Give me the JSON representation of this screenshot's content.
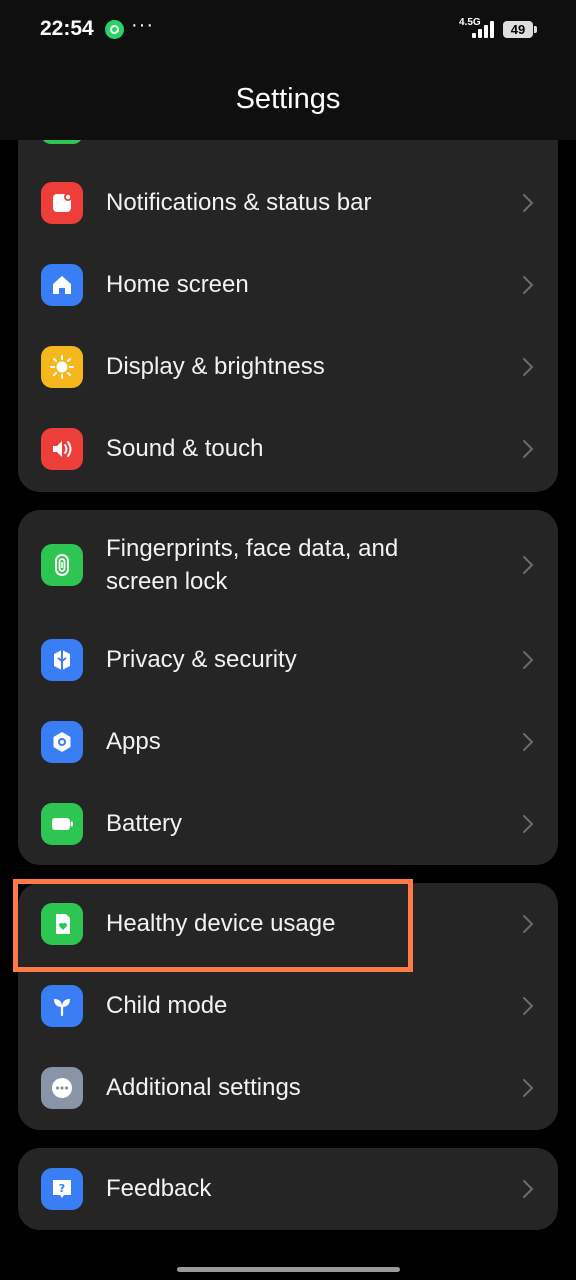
{
  "status_bar": {
    "time": "22:54",
    "network": "4.5G",
    "battery": "49",
    "overflow": "···"
  },
  "header": {
    "title": "Settings"
  },
  "groups": [
    {
      "items": [
        {
          "label": "Notifications & status bar",
          "icon": "notification-icon",
          "color": "#ee3e3a"
        },
        {
          "label": "Home screen",
          "icon": "home-icon",
          "color": "#3a7ef6"
        },
        {
          "label": "Display & brightness",
          "icon": "sun-icon",
          "color": "#f5b81c"
        },
        {
          "label": "Sound & touch",
          "icon": "speaker-icon",
          "color": "#ee3e3a"
        }
      ]
    },
    {
      "items": [
        {
          "label": "Fingerprints, face data, and screen lock",
          "icon": "fingerprint-icon",
          "color": "#2dc653"
        },
        {
          "label": "Privacy & security",
          "icon": "shield-icon",
          "color": "#3a7ef6"
        },
        {
          "label": "Apps",
          "icon": "apps-gear-icon",
          "color": "#3a7ef6"
        },
        {
          "label": "Battery",
          "icon": "battery-icon",
          "color": "#2dc653"
        }
      ]
    },
    {
      "items": [
        {
          "label": "Healthy device usage",
          "icon": "heart-phone-icon",
          "color": "#2dc653"
        },
        {
          "label": "Child mode",
          "icon": "sprout-icon",
          "color": "#3a7ef6"
        },
        {
          "label": "Additional settings",
          "icon": "more-dots-icon",
          "color": "#8a94a8"
        }
      ]
    },
    {
      "items": [
        {
          "label": "Feedback",
          "icon": "feedback-icon",
          "color": "#3a7ef6"
        }
      ]
    }
  ],
  "accent_highlight": "#ff7a45"
}
